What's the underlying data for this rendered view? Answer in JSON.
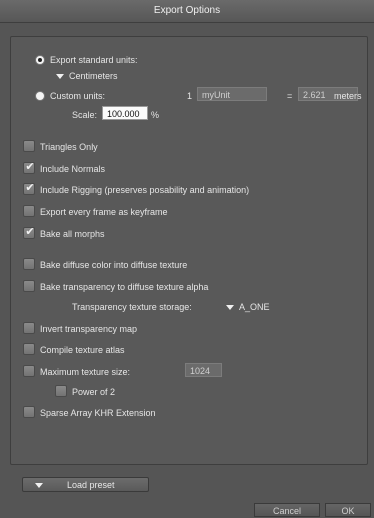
{
  "window": {
    "title": "Export Options"
  },
  "units": {
    "standard_label": "Export standard units:",
    "standard_selected": true,
    "unit_dropdown": "Centimeters",
    "custom_label": "Custom units:",
    "custom_selected": false,
    "custom_count": "1",
    "custom_name": "myUnit",
    "equals": "=",
    "custom_value": "2.621",
    "meters": "meters",
    "scale_label": "Scale:",
    "scale_value": "100.000",
    "scale_unit": "%"
  },
  "options": [
    {
      "label": "Triangles Only",
      "checked": false
    },
    {
      "label": "Include Normals",
      "checked": true
    },
    {
      "label": "Include Rigging (preserves posability and animation)",
      "checked": true
    },
    {
      "label": "Export every frame as keyframe",
      "checked": false
    },
    {
      "label": "Bake all morphs",
      "checked": true
    },
    {
      "label": "Bake diffuse color into diffuse texture",
      "checked": false
    },
    {
      "label": "Bake transparency to diffuse texture alpha",
      "checked": false
    }
  ],
  "transparency": {
    "label": "Transparency texture storage:",
    "value": "A_ONE"
  },
  "options2": [
    {
      "label": "Invert transparency map",
      "checked": false
    },
    {
      "label": "Compile texture atlas",
      "checked": false
    },
    {
      "label": "Maximum texture size:",
      "checked": false,
      "value": "1024"
    },
    {
      "label": "Power of 2",
      "checked": false
    },
    {
      "label": "Sparse Array KHR Extension",
      "checked": false
    }
  ],
  "footer": {
    "load_preset": "Load preset",
    "cancel": "Cancel",
    "ok": "OK"
  },
  "icons": {
    "check": "✔",
    "dropdown": "triangle-down-icon"
  }
}
